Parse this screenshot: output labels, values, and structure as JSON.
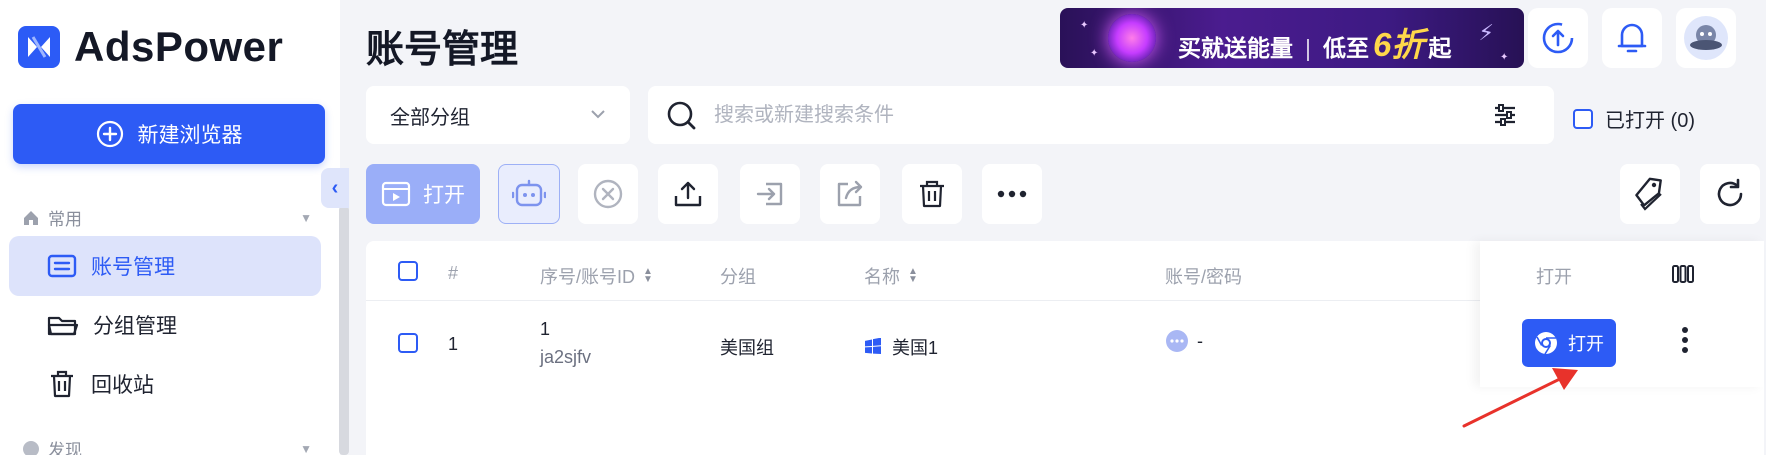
{
  "app": {
    "brand": "AdsPower"
  },
  "sidebar": {
    "new_browser_label": "新建浏览器",
    "collapse_icon": "chevron-left-icon",
    "sections": [
      {
        "label": "常用"
      },
      {
        "label": "发现"
      }
    ],
    "items": [
      {
        "label": "账号管理",
        "icon": "list-icon",
        "active": true
      },
      {
        "label": "分组管理",
        "icon": "folder-icon",
        "active": false
      },
      {
        "label": "回收站",
        "icon": "trash-icon",
        "active": false
      }
    ]
  },
  "header": {
    "title": "账号管理",
    "promo": {
      "text_a": "买就送能量",
      "sep": "|",
      "text_b": "低至",
      "big": "6折",
      "text_c": "起"
    },
    "icons": [
      "sync-icon",
      "bell-icon",
      "avatar"
    ]
  },
  "filters": {
    "group_select_value": "全部分组",
    "search_placeholder": "搜索或新建搜索条件",
    "opened_label": "已打开 (0)"
  },
  "toolbar": {
    "open_label": "打开",
    "buttons": [
      "robot-icon",
      "close-circle-icon",
      "upload-icon",
      "move-in-icon",
      "share-icon",
      "trash-icon",
      "more-icon",
      "tag-icon",
      "refresh-icon"
    ]
  },
  "table": {
    "columns": {
      "hash": "#",
      "serial": "序号/账号ID",
      "group": "分组",
      "name": "名称",
      "account": "账号/密码",
      "open": "打开"
    },
    "rows": [
      {
        "index": "1",
        "serial": "1",
        "account_id": "ja2sjfv",
        "group": "美国组",
        "name": "美国1",
        "password": "-",
        "open_label": "打开"
      }
    ]
  },
  "colors": {
    "primary": "#2d5bf5",
    "active_nav_bg": "#dde3fb",
    "open_disabled": "#9aaef8"
  }
}
